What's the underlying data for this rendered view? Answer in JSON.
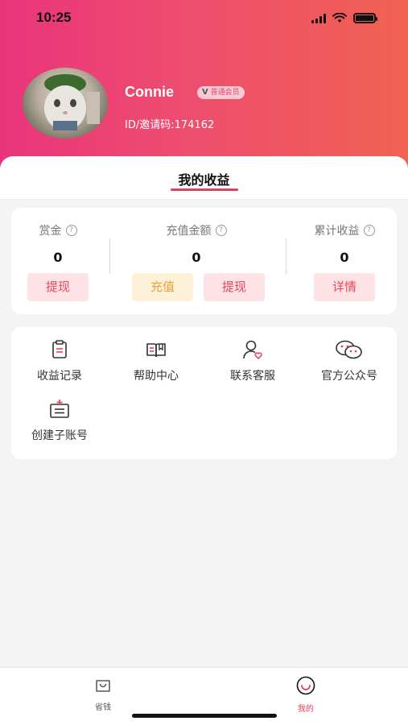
{
  "status_bar": {
    "time": "10:25"
  },
  "profile": {
    "name": "Connie",
    "badge_v": "V",
    "badge_text": "普通会员",
    "invite": "ID/邀请码:174162"
  },
  "tab": {
    "title": "我的收益"
  },
  "earnings": {
    "bounty": {
      "label": "赏金",
      "value": "0",
      "button": "提现"
    },
    "recharge": {
      "label": "充值金额",
      "value": "0",
      "button_recharge": "充值",
      "button_withdraw": "提现"
    },
    "total": {
      "label": "累计收益",
      "value": "0",
      "button": "详情"
    }
  },
  "menu": {
    "items": [
      {
        "label": "收益记录",
        "icon": "clipboard-icon"
      },
      {
        "label": "帮助中心",
        "icon": "book-icon"
      },
      {
        "label": "联系客服",
        "icon": "customer-service-icon"
      },
      {
        "label": "官方公众号",
        "icon": "wechat-icon"
      },
      {
        "label": "创建子账号",
        "icon": "create-account-icon"
      }
    ]
  },
  "bottom_nav": {
    "items": [
      {
        "label": "省钱",
        "icon": "shopping-bag-icon",
        "active": false
      },
      {
        "label": "我的",
        "icon": "smile-icon",
        "active": true
      }
    ]
  },
  "colors": {
    "accent": "#e2405a",
    "gradient_start": "#e9347b",
    "gradient_end": "#f16152",
    "recharge_text": "#e8a23a"
  }
}
